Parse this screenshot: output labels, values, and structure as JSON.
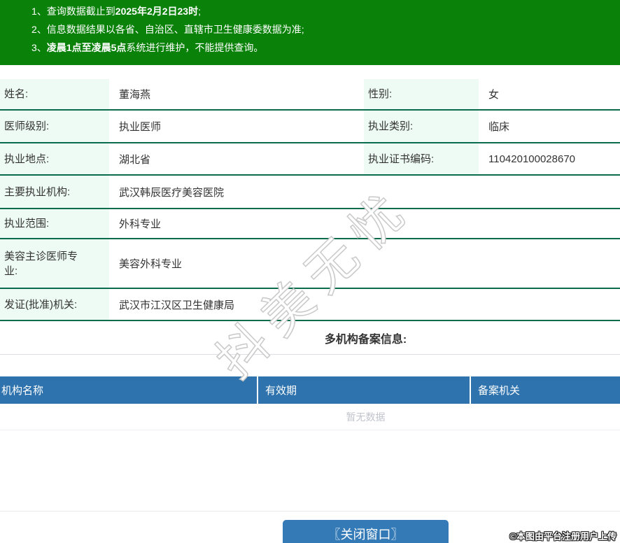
{
  "notices": {
    "items": [
      {
        "num": "1、",
        "pre": "查询数据截止到",
        "bold": "2025年2月2日23时",
        "post": ";"
      },
      {
        "num": "2、",
        "pre": "信息数据结果以各省、自治区、直辖市卫生健康委数据为准;",
        "bold": "",
        "post": ""
      },
      {
        "num": "3、",
        "pre": "",
        "bold": "凌晨1点至凌晨5点",
        "post": "系统进行维护，不能提供查询。"
      }
    ]
  },
  "profile": {
    "rows": [
      {
        "label": "姓名:",
        "value": "董海燕",
        "label2": "性别:",
        "value2": "女"
      },
      {
        "label": "医师级别:",
        "value": "执业医师",
        "label2": "执业类别:",
        "value2": "临床"
      },
      {
        "label": "执业地点:",
        "value": "湖北省",
        "label2": "执业证书编码:",
        "value2": "110420100028670"
      },
      {
        "label": "主要执业机构:",
        "value": "武汉韩辰医疗美容医院"
      },
      {
        "label": "执业范围:",
        "value": "外科专业"
      },
      {
        "label": "美容主诊医师专业:",
        "value": "美容外科专业"
      },
      {
        "label": "发证(批准)机关:",
        "value": "武汉市江汉区卫生健康局"
      }
    ]
  },
  "filing": {
    "title": "多机构备案信息:",
    "columns": [
      "机构名称",
      "有效期",
      "备案机关"
    ],
    "empty_text": "暂无数据"
  },
  "footer": {
    "close_button": "〖关闭窗口〗"
  },
  "watermark": {
    "text": "抖美无忧"
  },
  "credit": {
    "text": "©本图由平台注册用户上传"
  },
  "colors": {
    "banner_green": "#0a820a",
    "divider_green": "#0b6b4d",
    "label_bg": "#eefbf4",
    "header_blue": "#2e73ad",
    "button_blue": "#337ab7",
    "empty_gray": "#c0c4cc"
  }
}
